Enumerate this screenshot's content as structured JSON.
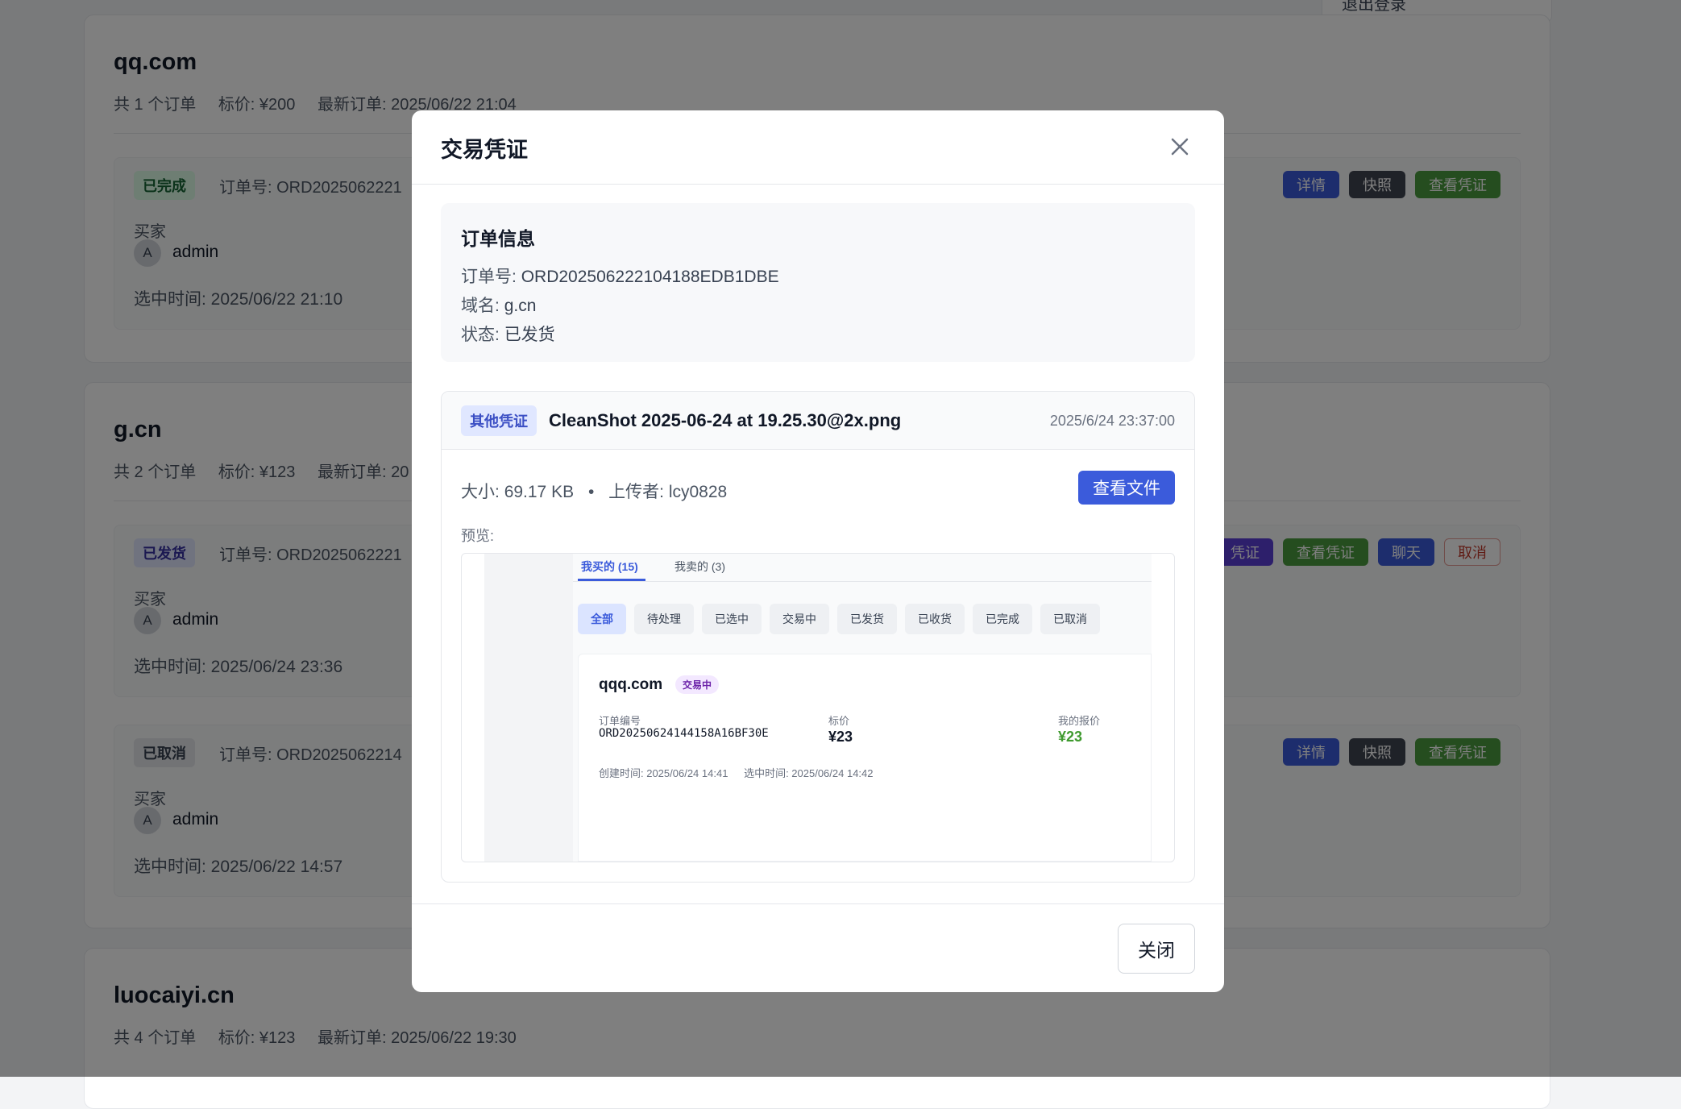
{
  "background": {
    "user_menu": {
      "logout_label": "退出登录"
    },
    "domains": [
      {
        "name": "qq.com",
        "meta": {
          "count": "共 1 个订单",
          "price": "标价: ¥200",
          "latest": "最新订单: 2025/06/22 21:04"
        },
        "orders": [
          {
            "status": "已完成",
            "order_no": "订单号: ORD2025062221",
            "buyer_label": "买家",
            "avatar": "A",
            "buyer": "admin",
            "select_time": "选中时间: 2025/06/22 21:10",
            "actions": [
              "详情",
              "快照",
              "查看凭证"
            ]
          }
        ]
      },
      {
        "name": "g.cn",
        "meta": {
          "count": "共 2 个订单",
          "price": "标价: ¥123",
          "latest": "最新订单: 20"
        },
        "orders": [
          {
            "status": "已发货",
            "order_no": "订单号: ORD2025062221",
            "buyer_label": "买家",
            "avatar": "A",
            "buyer": "admin",
            "select_time": "选中时间: 2025/06/24 23:36",
            "actions": [
              "凭证",
              "查看凭证",
              "聊天",
              "取消"
            ]
          },
          {
            "status": "已取消",
            "order_no": "订单号: ORD2025062214",
            "buyer_label": "买家",
            "avatar": "A",
            "buyer": "admin",
            "select_time": "选中时间: 2025/06/22 14:57",
            "actions": [
              "详情",
              "快照",
              "查看凭证"
            ]
          }
        ]
      },
      {
        "name": "luocaiyi.cn",
        "meta": {
          "count": "共 4 个订单",
          "price": "标价: ¥123",
          "latest": "最新订单: 2025/06/22 19:30"
        }
      }
    ]
  },
  "modal": {
    "title": "交易凭证",
    "close_icon": "close-icon",
    "order_info": {
      "title": "订单信息",
      "order_no_label": "订单号:",
      "order_no": "ORD202506222104188EDB1DBE",
      "domain_label": "域名:",
      "domain": "g.cn",
      "status_label": "状态:",
      "status": "已发货"
    },
    "voucher": {
      "type": "其他凭证",
      "file_name": "CleanShot 2025-06-24 at 19.25.30@2x.png",
      "uploaded_at": "2025/6/24 23:37:00",
      "size_label": "大小:",
      "size": "69.17 KB",
      "separator": "•",
      "uploader_label": "上传者:",
      "uploader": "lcy0828",
      "view_button": "查看文件",
      "preview_label": "预览:",
      "preview": {
        "tabs": [
          "我买的 (15)",
          "我卖的 (3)"
        ],
        "filters": [
          "全部",
          "待处理",
          "已选中",
          "交易中",
          "已发货",
          "已收货",
          "已完成",
          "已取消"
        ],
        "card": {
          "domain": "qqq.com",
          "status": "交易中",
          "order_no_label": "订单编号",
          "order_no": "ORD20250624144158A16BF30E",
          "price_label": "标价",
          "price": "¥23",
          "offer_label": "我的报价",
          "offer": "¥23",
          "created": "创建时间: 2025/06/24 14:41",
          "selected": "选中时间: 2025/06/24 14:42"
        }
      }
    },
    "footer_close": "关闭"
  }
}
